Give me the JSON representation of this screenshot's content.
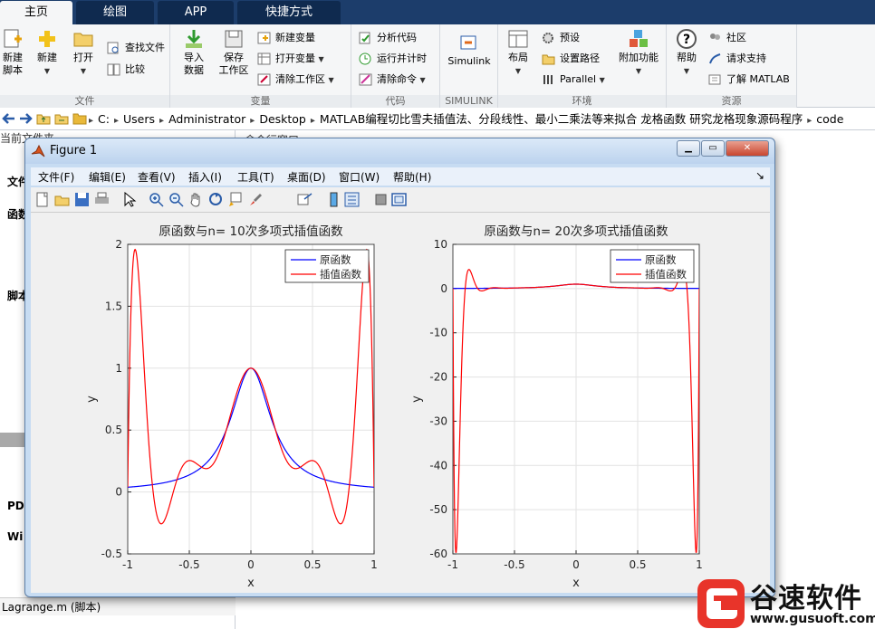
{
  "tabs": [
    "主页",
    "绘图",
    "APP",
    "快捷方式"
  ],
  "ribbon": {
    "file_group": {
      "label": "文件",
      "new_script": "新建\n脚本",
      "new": "新建",
      "open": "打开",
      "find_files": "查找文件",
      "compare": "比较"
    },
    "var_group": {
      "label": "变量",
      "import": "导入\n数据",
      "save_ws": "保存\n工作区",
      "new_var": "新建变量",
      "open_var": "打开变量",
      "clear_ws": "清除工作区"
    },
    "code_group": {
      "label": "代码",
      "analyze": "分析代码",
      "run_time": "运行并计时",
      "clear_cmds": "清除命令"
    },
    "simulink_group": {
      "label": "SIMULINK",
      "simulink": "Simulink"
    },
    "env_group": {
      "label": "环境",
      "layout": "布局",
      "prefs": "预设",
      "set_path": "设置路径",
      "parallel": "Parallel",
      "addons": "附加功能"
    },
    "res_group": {
      "label": "资源",
      "help": "帮助",
      "community": "社区",
      "support": "请求支持",
      "learn": "了解 MATLAB"
    }
  },
  "address": {
    "crumbs": [
      "C:",
      "Users",
      "Administrator",
      "Desktop",
      "MATLAB编程切比雪夫插值法、分段线性、最小二乘法等来拟合 龙格函数 研究龙格现象源码程序",
      "code"
    ]
  },
  "background": {
    "current_folder": "当前文件夹",
    "command_window": "命令行窗口",
    "side_labels": [
      "文件",
      "函数",
      "脚本",
      "PDF",
      "Wi"
    ],
    "status_file": "Lagrange.m (脚本)"
  },
  "figure": {
    "title": "Figure 1",
    "menu": [
      "文件(F)",
      "编辑(E)",
      "查看(V)",
      "插入(I)",
      "工具(T)",
      "桌面(D)",
      "窗口(W)",
      "帮助(H)"
    ]
  },
  "chart_data": [
    {
      "type": "line",
      "title": "原函数与n= 10次多项式插值函数",
      "xlabel": "x",
      "ylabel": "y",
      "xlim": [
        -1,
        1
      ],
      "ylim": [
        -0.5,
        2
      ],
      "xticks": [
        "-1",
        "-0.5",
        "0",
        "0.5",
        "1"
      ],
      "yticks": [
        "-0.5",
        "0",
        "0.5",
        "1",
        "1.5",
        "2"
      ],
      "grid": true,
      "legend_position": "top-right",
      "n": 10,
      "series": [
        {
          "name": "原函数",
          "color": "#0000ff"
        },
        {
          "name": "插值函数",
          "color": "#ff0000"
        }
      ]
    },
    {
      "type": "line",
      "title": "原函数与n= 20次多项式插值函数",
      "xlabel": "x",
      "ylabel": "y",
      "xlim": [
        -1,
        1
      ],
      "ylim": [
        -60,
        10
      ],
      "xticks": [
        "-1",
        "-0.5",
        "0",
        "0.5",
        "1"
      ],
      "yticks": [
        "-60",
        "-50",
        "-40",
        "-30",
        "-20",
        "-10",
        "0",
        "10"
      ],
      "grid": true,
      "legend_position": "top-right",
      "n": 20,
      "series": [
        {
          "name": "原函数",
          "color": "#0000ff"
        },
        {
          "name": "插值函数",
          "color": "#ff0000"
        }
      ]
    }
  ],
  "watermark": {
    "title": "谷速软件",
    "url": "www.gusuoft.com"
  }
}
